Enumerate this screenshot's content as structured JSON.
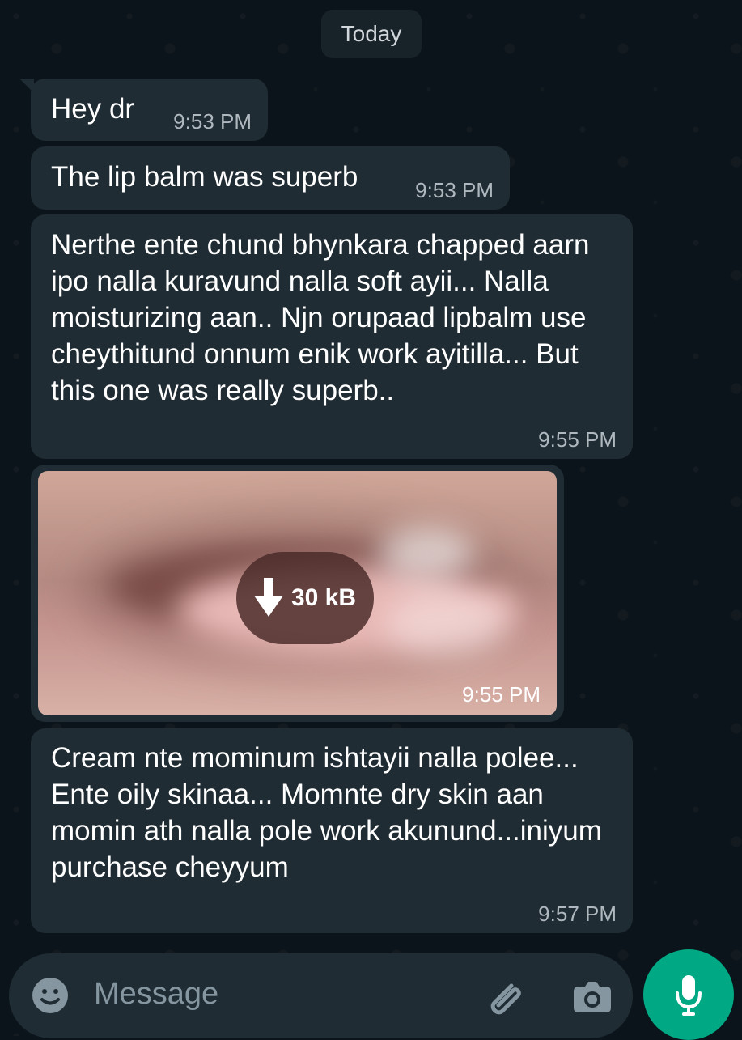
{
  "date_chip": "Today",
  "messages": [
    {
      "text": "Hey dr",
      "time": "9:53 PM"
    },
    {
      "text": "The lip balm was superb",
      "time": "9:53 PM"
    },
    {
      "text": "Nerthe ente chund bhynkara chapped aarn ipo nalla kuravund nalla soft ayii... Nalla moisturizing aan.. Njn orupaad lipbalm use cheythitund onnum enik work ayitilla... But this one was really superb..",
      "time": "9:55 PM"
    },
    {
      "image_size": "30 kB",
      "time": "9:55 PM"
    },
    {
      "text": "Cream nte mominum ishtayii nalla polee... Ente oily skinaa... Momnte dry skin aan momin ath nalla pole work akunund...iniyum purchase cheyyum",
      "time": "9:57 PM"
    }
  ],
  "composer": {
    "placeholder": "Message",
    "icons": {
      "emoji": "emoji-icon",
      "attach": "paperclip-icon",
      "camera": "camera-icon",
      "mic": "microphone-icon"
    }
  },
  "colors": {
    "bubble_background": "#202c33",
    "accent": "#00a884",
    "chat_background": "#0b141a"
  }
}
